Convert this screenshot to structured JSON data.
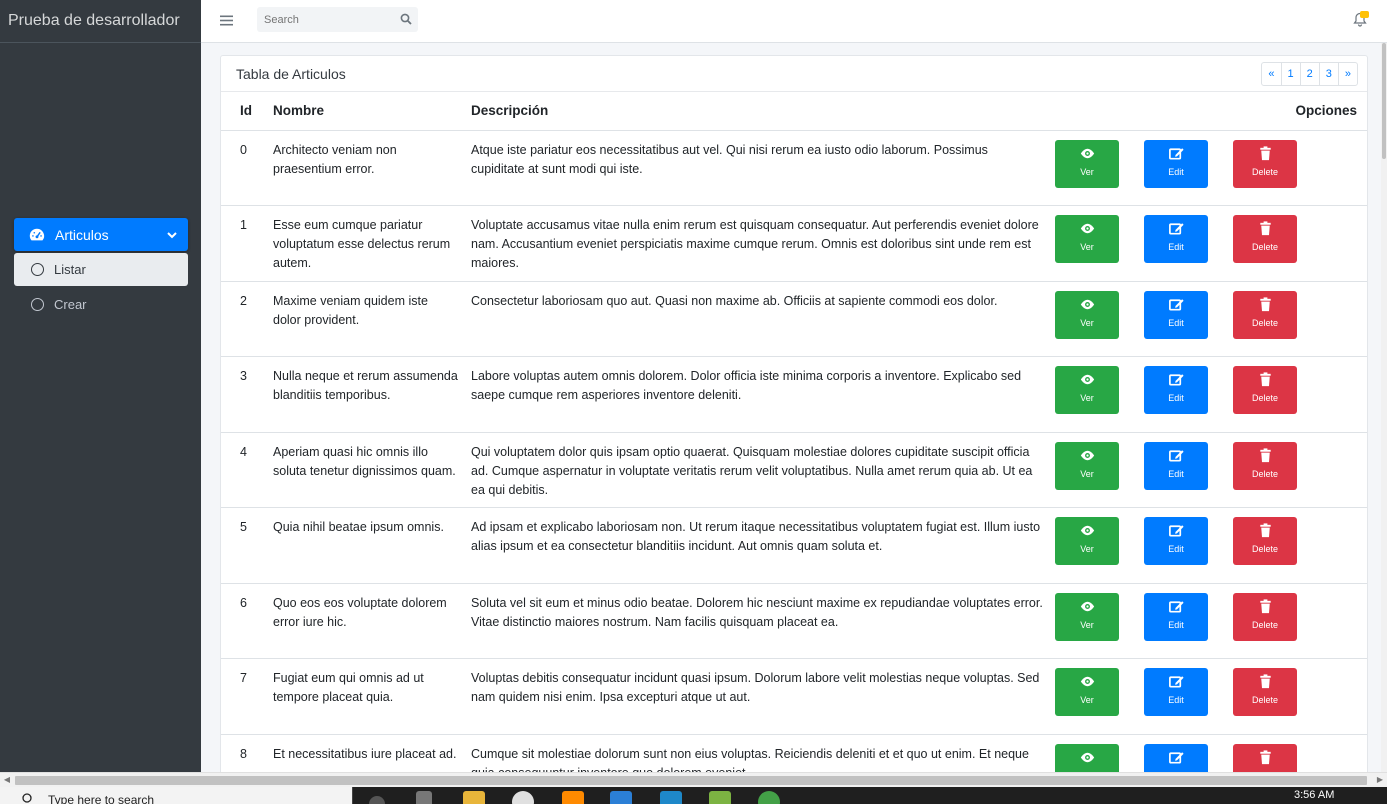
{
  "app": {
    "brand": "Prueba de desarrollador"
  },
  "sidebar": {
    "parent": {
      "label": "Articulos",
      "icon": "tachometer-icon"
    },
    "children": [
      {
        "label": "Listar",
        "active": true
      },
      {
        "label": "Crear",
        "active": false
      }
    ]
  },
  "topbar": {
    "search_placeholder": "Search",
    "notifications_badge": ""
  },
  "table": {
    "title": "Tabla de Articulos",
    "pagination": [
      "«",
      "1",
      "2",
      "3",
      "»"
    ],
    "headers": {
      "id": "Id",
      "nombre": "Nombre",
      "descripcion": "Descripción",
      "opciones": "Opciones"
    },
    "buttons": {
      "ver": "Ver",
      "edit": "Edit",
      "delete": "Delete"
    },
    "rows": [
      {
        "id": "0",
        "nombre": "Architecto veniam non praesentium error.",
        "descripcion": "Atque iste pariatur eos necessitatibus aut vel. Qui nisi rerum ea iusto odio laborum. Possimus cupiditate at sunt modi qui iste."
      },
      {
        "id": "1",
        "nombre": "Esse eum cumque pariatur voluptatum esse delectus rerum autem.",
        "descripcion": "Voluptate accusamus vitae nulla enim rerum est quisquam consequatur. Aut perferendis eveniet dolore nam. Accusantium eveniet perspiciatis maxime cumque rerum. Omnis est doloribus sint unde rem est maiores."
      },
      {
        "id": "2",
        "nombre": "Maxime veniam quidem iste dolor provident.",
        "descripcion": "Consectetur laboriosam quo aut. Quasi non maxime ab. Officiis at sapiente commodi eos dolor."
      },
      {
        "id": "3",
        "nombre": "Nulla neque et rerum assumenda blanditiis temporibus.",
        "descripcion": "Labore voluptas autem omnis dolorem. Dolor officia iste minima corporis a inventore. Explicabo sed saepe cumque rem asperiores inventore deleniti."
      },
      {
        "id": "4",
        "nombre": "Aperiam quasi hic omnis illo soluta tenetur dignissimos quam.",
        "descripcion": "Qui voluptatem dolor quis ipsam optio quaerat. Quisquam molestiae dolores cupiditate suscipit officia ad. Cumque aspernatur in voluptate veritatis rerum velit voluptatibus. Nulla amet rerum quia ab. Ut ea ea qui debitis."
      },
      {
        "id": "5",
        "nombre": "Quia nihil beatae ipsum omnis.",
        "descripcion": "Ad ipsam et explicabo laboriosam non. Ut rerum itaque necessitatibus voluptatem fugiat est. Illum iusto alias ipsum et ea consectetur blanditiis incidunt. Aut omnis quam soluta et."
      },
      {
        "id": "6",
        "nombre": "Quo eos eos voluptate dolorem error iure hic.",
        "descripcion": "Soluta vel sit eum et minus odio beatae. Dolorem hic nesciunt maxime ex repudiandae voluptates error. Vitae distinctio maiores nostrum. Nam facilis quisquam placeat ea."
      },
      {
        "id": "7",
        "nombre": "Fugiat eum qui omnis ad ut tempore placeat quia.",
        "descripcion": "Voluptas debitis consequatur incidunt quasi ipsum. Dolorum labore velit molestias neque voluptas. Sed nam quidem nisi enim. Ipsa excepturi atque ut aut."
      },
      {
        "id": "8",
        "nombre": "Et necessitatibus iure placeat ad.",
        "descripcion": "Cumque sit molestiae dolorum sunt non eius voluptas. Reiciendis deleniti et et quo ut enim. Et neque quia consequuntur inventore quo dolorem eveniet."
      }
    ]
  },
  "taskbar": {
    "search_text": "Type here to search",
    "clock": "3:56 AM"
  },
  "colors": {
    "sidebar_bg": "#343a40",
    "primary": "#007bff",
    "success": "#28a745",
    "danger": "#dc3545",
    "warning": "#ffc107"
  }
}
